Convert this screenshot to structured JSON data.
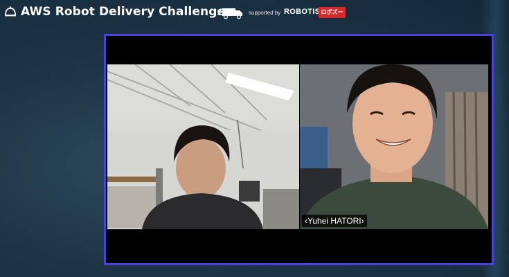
{
  "header": {
    "title": "AWS Robot Delivery Challenge",
    "supported_by": "supported by",
    "sponsor_robotis": "ROBOTIS",
    "sponsor_robozoo": "ロボズー",
    "icons": [
      "robot-dome-icon",
      "delivery-truck-icon"
    ]
  },
  "video_call": {
    "participants": [
      {
        "name": ""
      },
      {
        "name": "‹Yuhei HATORI›"
      }
    ]
  },
  "colors": {
    "frame_border": "#4842d8",
    "accent_red": "#d42a2a"
  }
}
